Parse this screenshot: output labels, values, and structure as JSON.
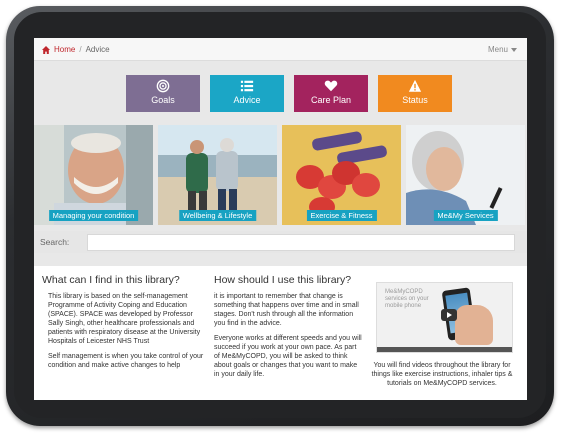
{
  "breadcrumb": {
    "home": "Home",
    "current": "Advice"
  },
  "menu_label": "Menu",
  "nav": [
    {
      "label": "Goals",
      "color": "#7e6e93",
      "icon": "target-icon"
    },
    {
      "label": "Advice",
      "color": "#1ba6c6",
      "icon": "list-icon"
    },
    {
      "label": "Care Plan",
      "color": "#a3235e",
      "icon": "heart-icon"
    },
    {
      "label": "Status",
      "color": "#f18a1f",
      "icon": "warning-icon"
    }
  ],
  "tiles": [
    {
      "caption": "Managing your condition"
    },
    {
      "caption": "Wellbeing & Lifestyle"
    },
    {
      "caption": "Exercise & Fitness"
    },
    {
      "caption": "Me&My Services"
    }
  ],
  "search": {
    "label": "Search:",
    "value": ""
  },
  "col1": {
    "heading": "What can I find in this library?",
    "p1": "This library is based on the self-management Programme of Activity Coping and Education (SPACE). SPACE was developed by Professor Sally Singh, other healthcare professionals and patients with respiratory disease at the University Hospitals of Leicester NHS Trust",
    "p2": "Self management is when you take control of your condition and make active changes to help"
  },
  "col2": {
    "heading": "How should I use this library?",
    "p1": "it is important to remember that change is something that happens over time and in small stages. Don't rush through all the information you find in the advice.",
    "p2": "Everyone works at different speeds and you will succeed if you work at your own pace.  As part of Me&MyCOPD, you will be asked to think about goals or changes that you want to make in your daily life."
  },
  "video": {
    "thumb_text": "Me&MyCOPD services on your mobile phone",
    "caption": "You will find videos throughout the library for things like exercise instructions, inhaler tips & tutorials on Me&MyCOPD services."
  }
}
